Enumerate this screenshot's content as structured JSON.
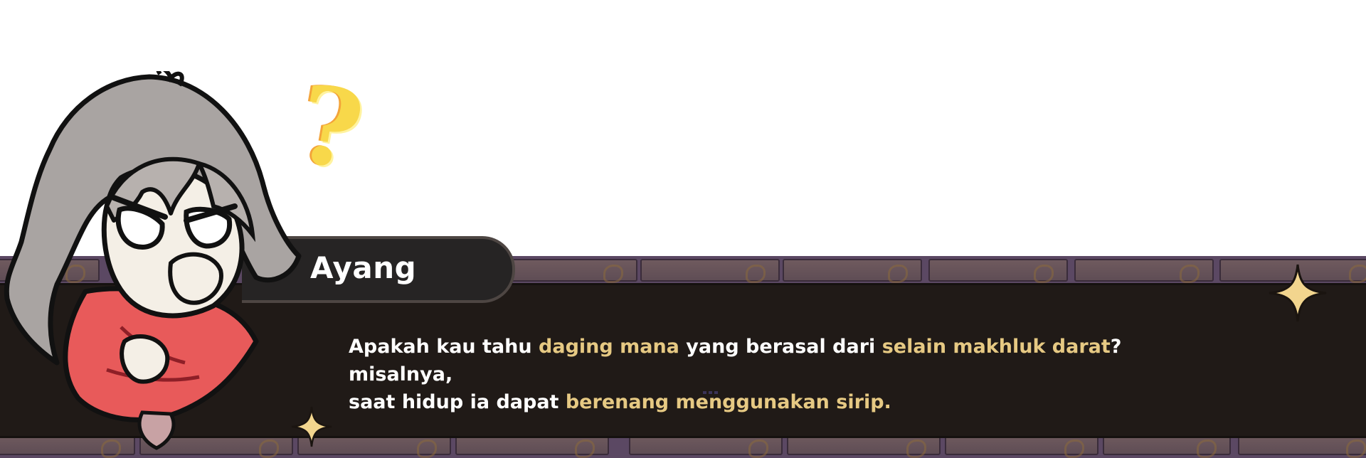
{
  "speaker": {
    "name": "Ayang"
  },
  "dialogue": {
    "line1": [
      {
        "text": "Apakah kau tahu ",
        "highlight": false
      },
      {
        "text": "daging mana",
        "highlight": true
      },
      {
        "text": " yang berasal dari ",
        "highlight": false
      },
      {
        "text": "selain makhluk darat",
        "highlight": true
      },
      {
        "text": "? misalnya,",
        "highlight": false
      }
    ],
    "line2": [
      {
        "text": "saat hidup ia dapat ",
        "highlight": false
      },
      {
        "text": "berenang menggunakan sirip.",
        "highlight": true
      }
    ]
  },
  "portrait": {
    "emote": "?"
  },
  "colors": {
    "dialog_bg": "#201a17",
    "name_plate": "#262424",
    "highlight": "#e6c983",
    "text": "#ffffff",
    "question_mark": "#f8d84a",
    "brick": "#6f5a5e"
  },
  "icons": [
    "question-mark-emote",
    "sparkle-icon",
    "continue-indicator"
  ]
}
